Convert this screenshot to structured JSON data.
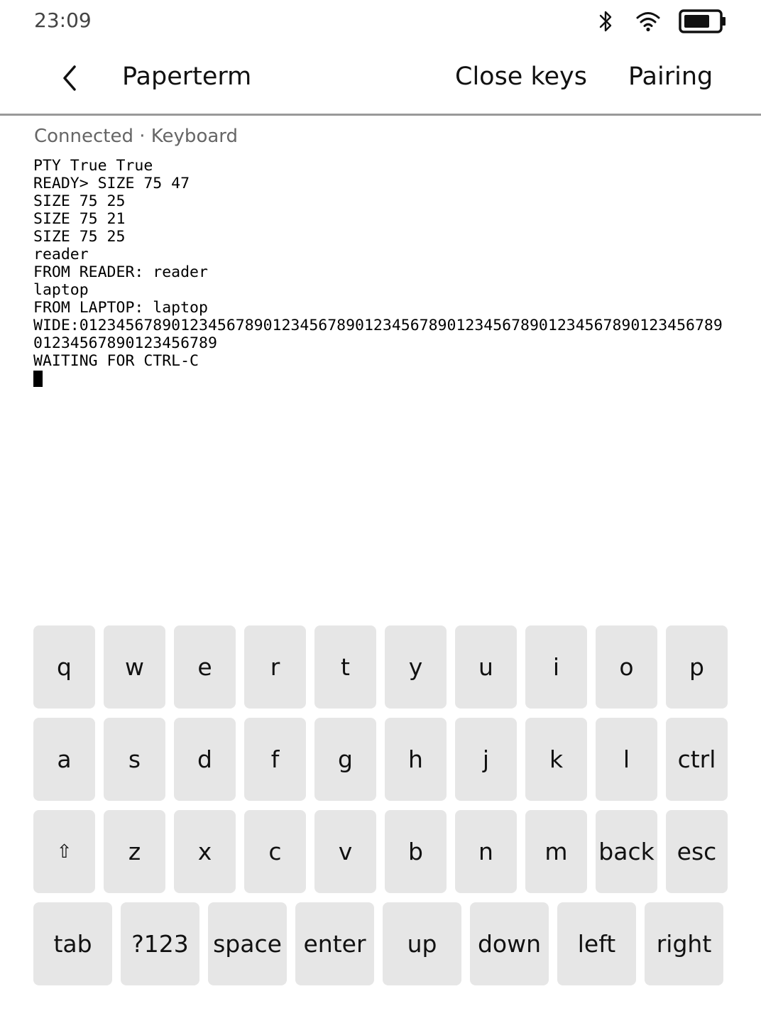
{
  "status_bar": {
    "time": "23:09",
    "icons": [
      "bluetooth-icon",
      "wifi-icon",
      "battery-icon"
    ],
    "battery_level": 0.75
  },
  "app_bar": {
    "title": "Paperterm",
    "actions": {
      "close_keys": "Close keys",
      "pairing": "Pairing"
    },
    "back_icon": "chevron-left-icon"
  },
  "connection_status": "Connected · Keyboard",
  "terminal": {
    "lines": [
      "PTY True True",
      "READY> SIZE 75 47",
      "SIZE 75 25",
      "SIZE 75 21",
      "SIZE 75 25",
      "reader",
      "FROM READER: reader",
      "laptop",
      "FROM LAPTOP: laptop",
      "WIDE:012345678901234567890123456789012345678901234567890123456789012345678901234567890123456789",
      "WAITING FOR CTRL-C",
      ""
    ]
  },
  "keyboard": {
    "rows": [
      [
        "q",
        "w",
        "e",
        "r",
        "t",
        "y",
        "u",
        "i",
        "o",
        "p"
      ],
      [
        "a",
        "s",
        "d",
        "f",
        "g",
        "h",
        "j",
        "k",
        "l",
        "ctrl"
      ],
      [
        "⇧",
        "z",
        "x",
        "c",
        "v",
        "b",
        "n",
        "m",
        "back",
        "esc"
      ],
      [
        "tab",
        "?123",
        "space",
        "enter",
        "up",
        "down",
        "left",
        "right"
      ]
    ]
  },
  "colors": {
    "key_background": "#e6e6e6",
    "divider": "#999999",
    "status_text": "#666666"
  }
}
